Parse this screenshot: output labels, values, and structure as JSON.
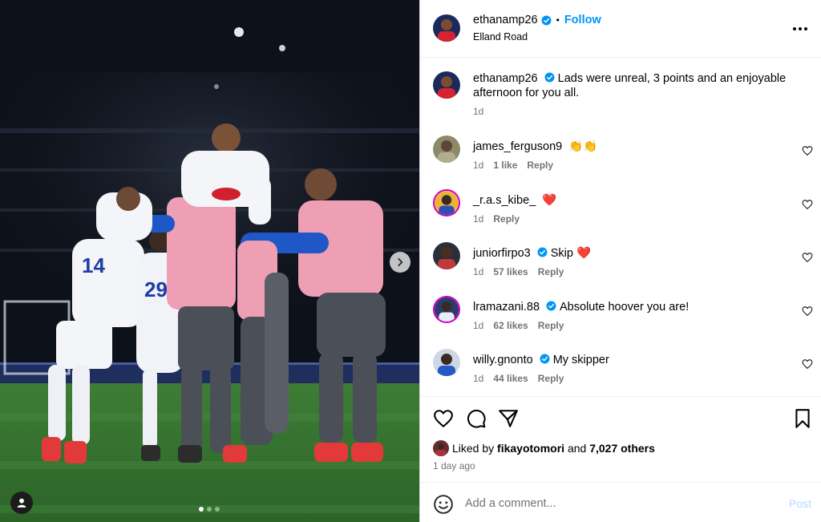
{
  "post": {
    "author": "ethanamp26",
    "location": "Elland Road",
    "follow_label": "Follow",
    "separator": "•",
    "caption": "Lads were unreal, 3 points and an enjoyable afternoon for you all.",
    "caption_time": "1d",
    "more_icon": "more-horizontal-icon",
    "carousel": {
      "slide_count": 3,
      "active_slide": 1
    }
  },
  "comments": [
    {
      "user": "james_ferguson9",
      "text": "👏👏",
      "time": "1d",
      "likes": "1 like",
      "reply": "Reply",
      "verified": false
    },
    {
      "user": "_r.a.s_kibe_",
      "text": "❤️",
      "time": "1d",
      "likes": "",
      "reply": "Reply",
      "verified": false
    },
    {
      "user": "juniorfirpo3",
      "text": "Skip ❤️",
      "time": "1d",
      "likes": "57 likes",
      "reply": "Reply",
      "verified": true
    },
    {
      "user": "lramazani.88",
      "text": "Absolute hoover you are!",
      "time": "1d",
      "likes": "62 likes",
      "reply": "Reply",
      "verified": true
    },
    {
      "user": "willy.gnonto",
      "text": "My skipper",
      "time": "1d",
      "likes": "44 likes",
      "reply": "Reply",
      "verified": true
    }
  ],
  "actions": {
    "liked_prefix": "Liked by",
    "liked_user": "fikayotomori",
    "liked_and": "and",
    "liked_others": "7,027 others",
    "time_ago": "1 day ago"
  },
  "composer": {
    "placeholder": "Add a comment...",
    "post_label": "Post"
  },
  "colors": {
    "accent": "#0095f6",
    "muted": "#737373",
    "verified": "#0095f6",
    "heart": "#ff3040"
  }
}
